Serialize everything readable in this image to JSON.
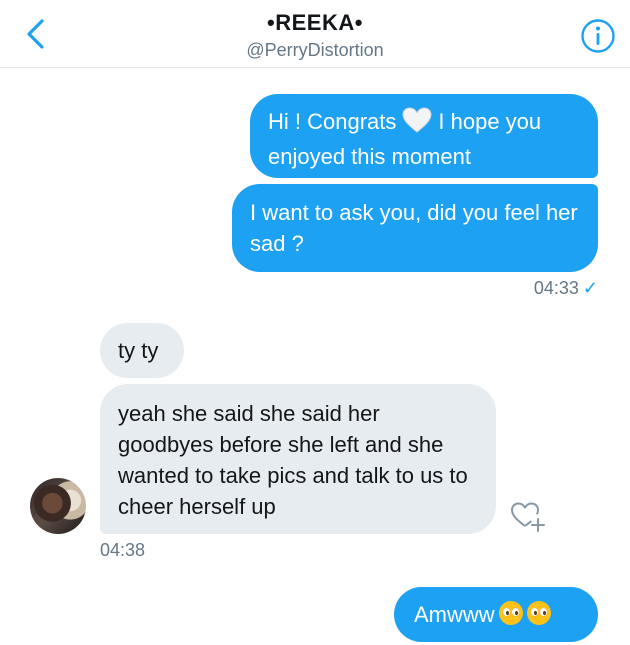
{
  "header": {
    "title": "•REEKA•",
    "handle": "@PerryDistortion"
  },
  "messages": [
    {
      "direction": "outgoing",
      "text_before": "Hi ! Congrats",
      "icon": "white-heart-icon",
      "text_after": "I hope you enjoyed this moment"
    },
    {
      "direction": "outgoing",
      "text": "I want to ask you, did you feel her sad ?"
    },
    {
      "direction": "incoming",
      "text": "ty ty"
    },
    {
      "direction": "incoming",
      "text": "yeah she said she said her goodbyes before she left and she wanted to take pics and talk to us to cheer herself up"
    },
    {
      "direction": "outgoing",
      "text": "Amwww",
      "emojis": [
        "pleading-face-emoji",
        "pleading-face-emoji"
      ]
    }
  ],
  "meta": {
    "outgoing_time": "04:33",
    "read_mark": "✓",
    "incoming_time": "04:38"
  },
  "colors": {
    "outgoing_bubble": "#1da1f2",
    "incoming_bubble": "#e6ecf0",
    "accent": "#1da1f2",
    "muted_text": "#657786"
  }
}
